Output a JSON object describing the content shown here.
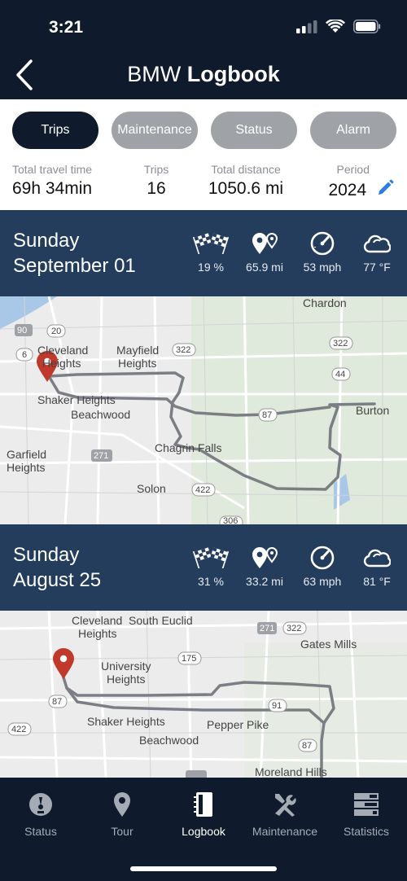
{
  "status_bar": {
    "time": "3:21"
  },
  "header": {
    "title_light": "BMW",
    "title_bold": "Logbook"
  },
  "tabs": [
    {
      "label": "Trips",
      "active": true
    },
    {
      "label": "Maintenance",
      "active": false
    },
    {
      "label": "Status",
      "active": false
    },
    {
      "label": "Alarm",
      "active": false
    }
  ],
  "summary": {
    "travel_time": {
      "label": "Total travel time",
      "value": "69h 34min"
    },
    "trips": {
      "label": "Trips",
      "value": "16"
    },
    "distance": {
      "label": "Total distance",
      "value": "1050.6 mi"
    },
    "period": {
      "label": "Period",
      "value": "2024"
    }
  },
  "trips": [
    {
      "day": "Sunday",
      "date": "September 01",
      "score": "19 %",
      "distance": "65.9 mi",
      "speed": "53 mph",
      "temp": "77 °F",
      "map_labels": {
        "chardon": "Chardon",
        "cleveland": "Cleveland",
        "heights": "Heights",
        "mayfield": "Mayfield",
        "mayfield2": "Heights",
        "shaker": "Shaker Heights",
        "beachwood": "Beachwood",
        "burton": "Burton",
        "chagrin": "Chagrin Falls",
        "garfield": "Garfield",
        "garfield2": "Heights",
        "solon": "Solon",
        "r90": "90",
        "r20": "20",
        "r6": "6",
        "r322a": "322",
        "r322b": "322",
        "r44": "44",
        "r87": "87",
        "r271": "271",
        "r422": "422",
        "r306": "306"
      }
    },
    {
      "day": "Sunday",
      "date": "August 25",
      "score": "31 %",
      "distance": "33.2 mi",
      "speed": "63 mph",
      "temp": "81 °F",
      "map_labels": {
        "cleveland": "Cleveland",
        "heights": "Heights",
        "south_euclid": "South Euclid",
        "gates": "Gates Mills",
        "university": "University",
        "university2": "Heights",
        "shaker": "Shaker Heights",
        "pepper": "Pepper Pike",
        "beachwood": "Beachwood",
        "moreland": "Moreland Hills",
        "r271": "271",
        "r322": "322",
        "r175": "175",
        "r91": "91",
        "r87a": "87",
        "r87b": "87",
        "r422": "422"
      }
    }
  ],
  "nav": [
    {
      "label": "Status",
      "icon": "gauge-icon",
      "active": false
    },
    {
      "label": "Tour",
      "icon": "location-pin-icon",
      "active": false
    },
    {
      "label": "Logbook",
      "icon": "notebook-icon",
      "active": true
    },
    {
      "label": "Maintenance",
      "icon": "wrench-screwdriver-icon",
      "active": false
    },
    {
      "label": "Statistics",
      "icon": "statistics-icon",
      "active": false
    }
  ],
  "colors": {
    "navy": "#0f1b2c",
    "band": "#243d5c",
    "pin": "#c0392b",
    "route": "#7b7f84",
    "accent": "#2f7de1"
  }
}
